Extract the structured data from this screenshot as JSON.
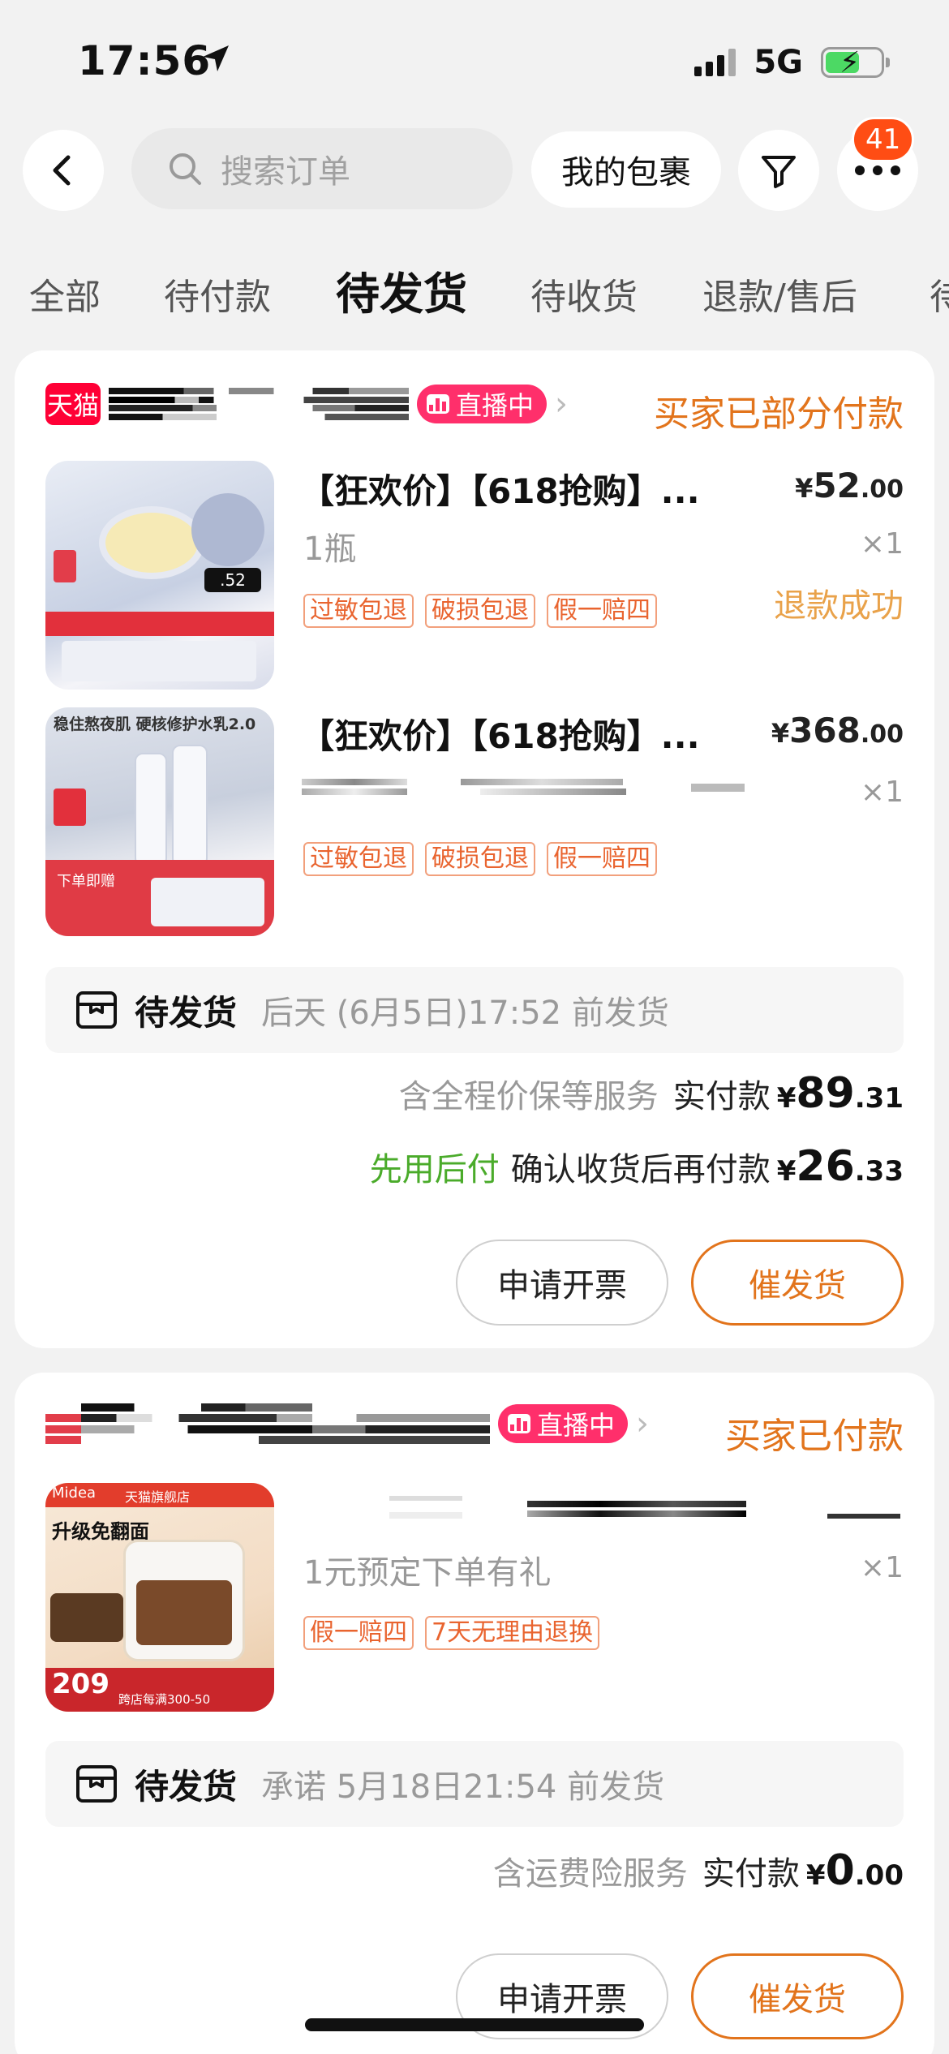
{
  "status_bar": {
    "time": "17:56",
    "network": "5G"
  },
  "header": {
    "search_placeholder": "搜索订单",
    "packages_button": "我的包裹",
    "more_badge": "41"
  },
  "tabs": [
    "全部",
    "待付款",
    "待发货",
    "待收货",
    "退款/售后",
    "待"
  ],
  "active_tab": "待发货",
  "orders": [
    {
      "shop_badge": "天猫",
      "live_label": "直播中",
      "status": "买家已部分付款",
      "items": [
        {
          "title": "【狂欢价】【618抢购】...",
          "price_int": "52",
          "price_dec": ".00",
          "spec": "1瓶",
          "qty": "×1",
          "refund": "退款成功",
          "tags": [
            "过敏包退",
            "破损包退",
            "假一赔四"
          ]
        },
        {
          "title": "【狂欢价】【618抢购】...",
          "price_int": "368",
          "price_dec": ".00",
          "spec": "",
          "qty": "×1",
          "refund": "",
          "tags": [
            "过敏包退",
            "破损包退",
            "假一赔四"
          ]
        }
      ],
      "ship_label": "待发货",
      "ship_time": "后天 (6月5日)17:52 前发货",
      "service_note": "含全程价保等服务",
      "paid_label": "实付款",
      "paid_int": "89",
      "paid_dec": ".31",
      "bnpl_label": "先用后付",
      "bnpl_text": "确认收货后再付款",
      "bnpl_int": "26",
      "bnpl_dec": ".33",
      "btn_invoice": "申请开票",
      "btn_urge": "催发货"
    },
    {
      "live_label": "直播中",
      "status": "买家已付款",
      "items": [
        {
          "spec": "1元预定下单有礼",
          "qty": "×1",
          "tags": [
            "假一赔四",
            "7天无理由退换"
          ]
        }
      ],
      "ship_label": "待发货",
      "ship_time": "承诺 5月18日21:54 前发货",
      "service_note": "含运费险服务",
      "paid_label": "实付款",
      "paid_int": "0",
      "paid_dec": ".00",
      "btn_invoice": "申请开票",
      "btn_urge": "催发货"
    }
  ],
  "currency": "¥",
  "thumbs": {
    "p1_price": ".52",
    "p2_header": "稳住熬夜肌 硬核修护水乳2.0",
    "p2_cta": "下单即赠",
    "p3_brand": "Midea",
    "p3_store": "天猫旗舰店",
    "p3_promo": "升级免翻面",
    "p3_price": "209",
    "p3_footer": "跨店每满300-50"
  },
  "colors": {
    "accent": "#e2741c",
    "live": "#ff2f6b",
    "tmall": "#ff0036",
    "bnpl": "#4aab2a",
    "badge": "#ff4d14"
  }
}
